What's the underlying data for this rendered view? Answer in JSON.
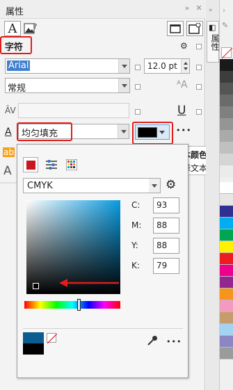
{
  "panel": {
    "title": "属性",
    "title_icons": [
      "double-chevron-right-icon",
      "close-icon"
    ],
    "section_label": "字符",
    "font_name": "Arial",
    "font_size": "12.0 pt",
    "font_style": "常规",
    "fill_type": "均匀填充",
    "fill_color": "#000000",
    "more_label": "•••",
    "char_a": "A",
    "kern_symbol": "ĀV",
    "underline_symbol": "U",
    "ab_symbol": "ab"
  },
  "tooltip": {
    "title": "文本颜色",
    "description": "选择文本颜色。"
  },
  "popup": {
    "color_model": "CMYK",
    "cmyk": [
      {
        "label": "C:",
        "value": "93"
      },
      {
        "label": "M:",
        "value": "88"
      },
      {
        "label": "Y:",
        "value": "88"
      },
      {
        "label": "K:",
        "value": "79"
      }
    ],
    "current_color": "#0b5c8f",
    "new_color": "#000000",
    "more_label": "•••",
    "picker_level": {
      "saturation": 0.07,
      "value": 0.05
    },
    "hue_fraction": 0.55
  },
  "side_tabs": {
    "vertical_label": "属性"
  },
  "palette_colors": [
    "#ffffff",
    "#1a1a1a",
    "#3d3d3d",
    "#555555",
    "#6b6b6b",
    "#808080",
    "#959595",
    "#aaaaaa",
    "#c0c0c0",
    "#d5d5d5",
    "#ebebeb",
    "#ffffff",
    "#e6e6e6",
    "#2e3192",
    "#00aeef",
    "#00a651",
    "#fff200",
    "#ed1c24",
    "#ec008c",
    "#92278f",
    "#f7941d",
    "#f49ac1",
    "#c69c6d",
    "#a3d3f2",
    "#8c87c4",
    "#9b9b9b"
  ]
}
